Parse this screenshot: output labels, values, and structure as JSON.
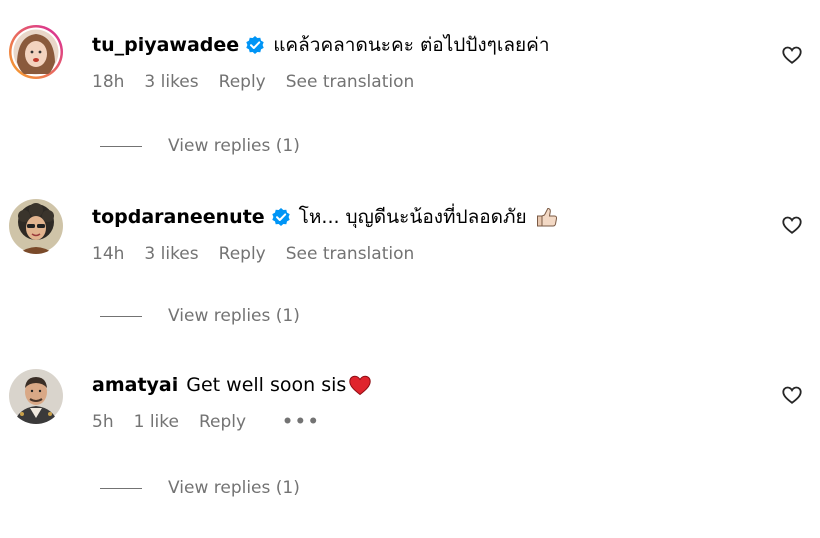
{
  "comments": [
    {
      "username": "tu_piyawadee",
      "verified": true,
      "text": "แคล้วคลาดนะคะ ต่อไปปังๆเลยค่า",
      "time": "18h",
      "likes": "3 likes",
      "reply": "Reply",
      "translate": "See translation",
      "view_replies": "View replies (1)",
      "avatar_icon": "profile-photo-woman"
    },
    {
      "username": "topdaraneenute",
      "verified": true,
      "text": "โห... บุญดีนะน้องที่ปลอดภัย",
      "emoji": "thumbs-up-emoji",
      "time": "14h",
      "likes": "3 likes",
      "reply": "Reply",
      "translate": "See translation",
      "view_replies": "View replies (1)",
      "avatar_icon": "profile-photo-woman-curly-hair"
    },
    {
      "username": "amatyai",
      "verified": false,
      "text": "Get well soon sis",
      "emoji": "red-heart-emoji",
      "time": "5h",
      "likes": "1 like",
      "reply": "Reply",
      "more": "•••",
      "view_replies": "View replies (1)",
      "avatar_icon": "profile-photo-man"
    }
  ],
  "colors": {
    "meta_text": "#737373",
    "verified_blue": "#0095f6",
    "story_ring_start": "#f9a825",
    "story_ring_end": "#d6249f"
  },
  "icons": {
    "like": "heart-outline-icon",
    "verified": "verified-badge-icon"
  }
}
